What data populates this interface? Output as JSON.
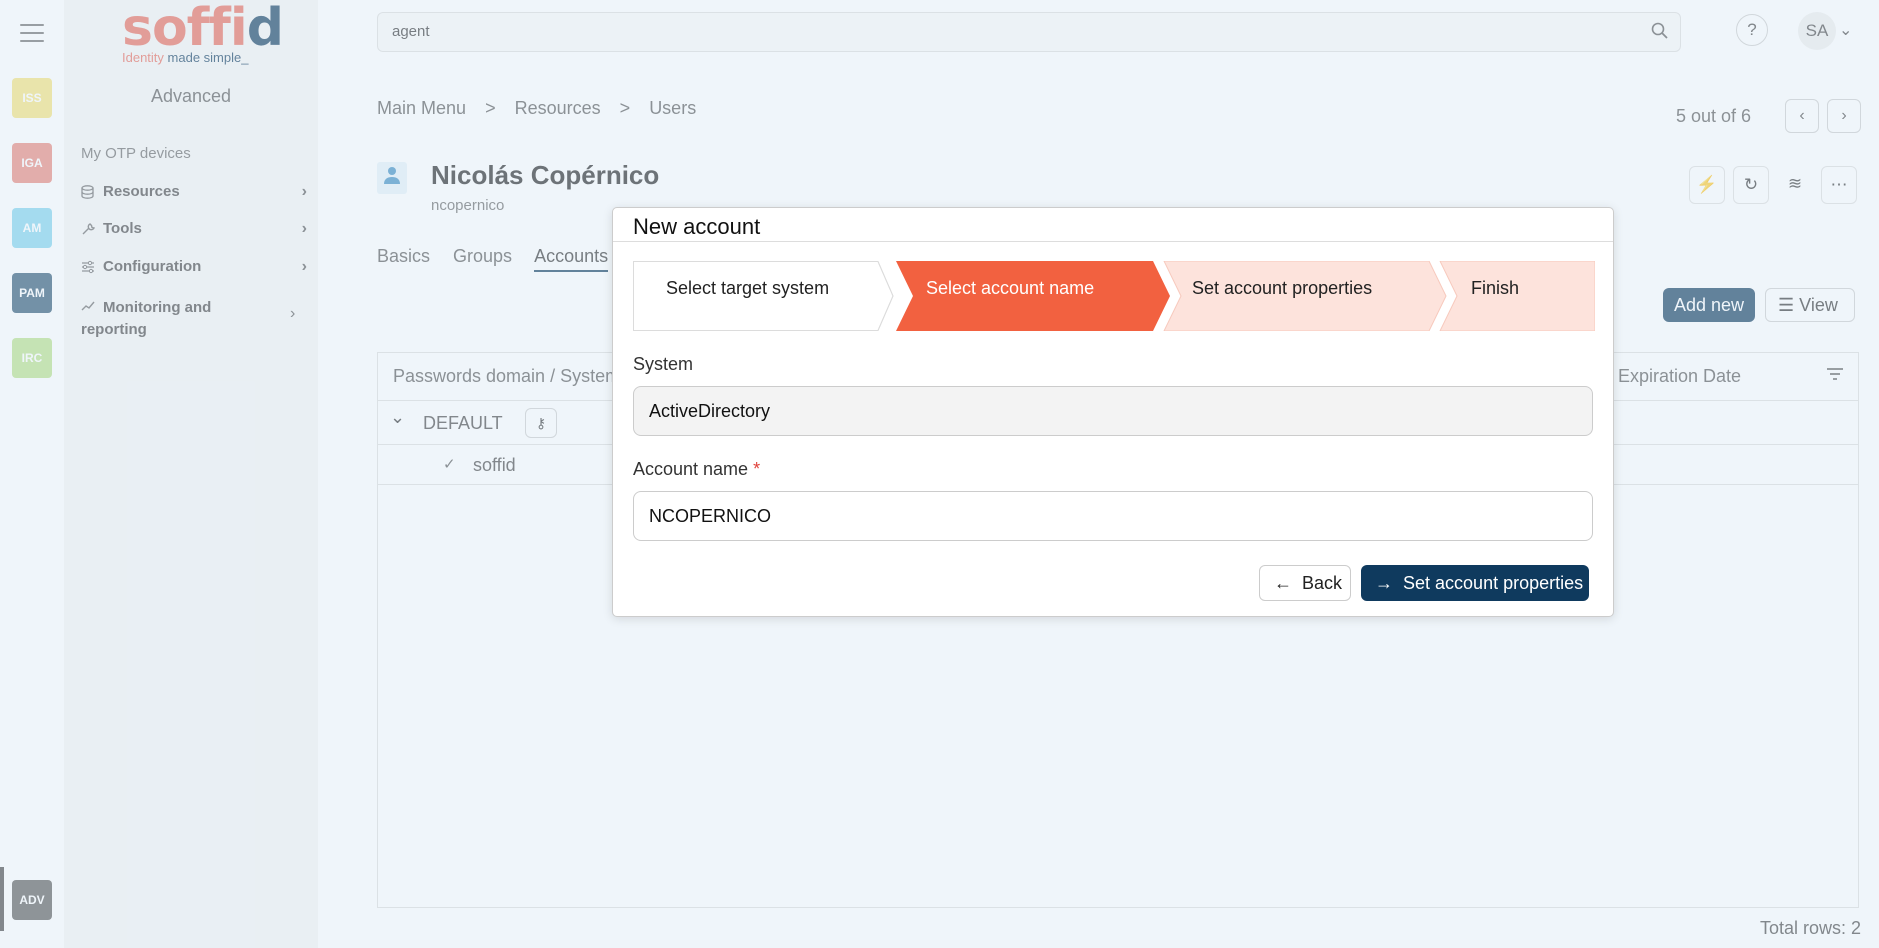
{
  "rail": {
    "apps": [
      {
        "label": "ISS",
        "color": "#f5e27a"
      },
      {
        "label": "IGA",
        "color": "#e9847a"
      },
      {
        "label": "AM",
        "color": "#7fd3ee"
      },
      {
        "label": "PAM",
        "color": "#2b5472"
      },
      {
        "label": "IRC",
        "color": "#b7e08a"
      }
    ],
    "bottom_app": {
      "label": "ADV",
      "color": "#5a5a5a"
    }
  },
  "logo": {
    "word_a": "soffi",
    "word_b": "d",
    "tag_a": "Identity ",
    "tag_b": "made simple_"
  },
  "sidebar": {
    "title": "Advanced",
    "items": [
      {
        "label": "My OTP devices"
      },
      {
        "label": "Resources",
        "icon": "database-icon"
      },
      {
        "label": "Tools",
        "icon": "wrench-icon"
      },
      {
        "label": "Configuration",
        "icon": "sliders-icon"
      },
      {
        "label": "Monitoring and reporting",
        "icon": "chart-line-icon"
      }
    ]
  },
  "topbar": {
    "search_value": "agent",
    "help": "?",
    "user_initials": "SA"
  },
  "breadcrumb": [
    "Main Menu",
    ">",
    "Resources",
    ">",
    "Users"
  ],
  "pager": {
    "text": "5 out of 6"
  },
  "user": {
    "name": "Nicolás Copérnico",
    "login": "ncopernico"
  },
  "tabs": [
    "Basics",
    "Groups",
    "Accounts"
  ],
  "toolbar": {
    "add_new": "Add new",
    "view": "View"
  },
  "grid": {
    "col_domain": "Passwords domain / System",
    "col_expiration": "Expiration Date",
    "group_label": "DEFAULT",
    "row_label": "soffid",
    "total_rows": "Total rows: 2"
  },
  "dialog": {
    "title": "New account",
    "steps": [
      {
        "label": "Select target system",
        "state": "done"
      },
      {
        "label": "Select account name",
        "state": "active"
      },
      {
        "label": "Set account properties",
        "state": "pending"
      },
      {
        "label": "Finish",
        "state": "pending"
      }
    ],
    "system_label": "System",
    "system_value": "ActiveDirectory",
    "account_label": "Account name",
    "account_required": "*",
    "account_value": "NCOPERNICO",
    "back_label": "Back",
    "next_label": "Set account properties"
  },
  "colors": {
    "accent": "#0f3a5e",
    "active_step": "#f26140",
    "pending_step": "#fde3dc",
    "brand": "#e9695a"
  }
}
